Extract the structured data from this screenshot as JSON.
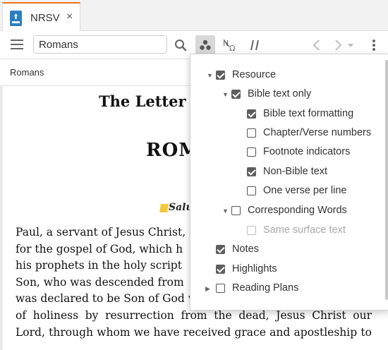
{
  "tab": {
    "label": "NRSV",
    "close": "×",
    "icon": "bible-book-icon"
  },
  "toolbar": {
    "reference_value": "Romans",
    "icons": [
      "menu-icon",
      "search-icon",
      "visual-filters-icon",
      "interlinear-icon",
      "parallel-icon",
      "back-icon",
      "forward-icon",
      "dropdown-icon",
      "more-icon"
    ]
  },
  "breadcrumb": "Romans",
  "document": {
    "title": "The Letter of",
    "book": "ROM",
    "heading": "Salu",
    "lines": [
      "Paul, a servant of Jesus Christ,",
      "for the gospel of God, which h",
      "his prophets in the holy script",
      "Son, who was descended from",
      "was declared to be Son of God w",
      "of holiness by resurrection from the dead, Jesus Christ our",
      "Lord, through whom we have received grace and apostleship to"
    ]
  },
  "visual_filters": {
    "resource": {
      "label": "Resource",
      "checked": true
    },
    "bible_text_only": {
      "label": "Bible text only",
      "checked": true
    },
    "bible_text_formatting": {
      "label": "Bible text formatting",
      "checked": true
    },
    "chapter_verse_numbers": {
      "label": "Chapter/Verse numbers",
      "checked": false
    },
    "footnote_indicators": {
      "label": "Footnote indicators",
      "checked": false
    },
    "non_bible_text": {
      "label": "Non-Bible text",
      "checked": true
    },
    "one_verse_per_line": {
      "label": "One verse per line",
      "checked": false
    },
    "corresponding_words": {
      "label": "Corresponding Words",
      "checked": false
    },
    "same_surface_text": {
      "label": "Same surface text",
      "checked": false,
      "disabled": true
    },
    "notes": {
      "label": "Notes",
      "checked": true
    },
    "highlights": {
      "label": "Highlights",
      "checked": true
    },
    "reading_plans": {
      "label": "Reading Plans",
      "checked": false
    }
  },
  "colors": {
    "tab_accent": "#e8741c",
    "highlight_marker": "#f3c93a",
    "icon_blue": "#2c7fbf"
  }
}
